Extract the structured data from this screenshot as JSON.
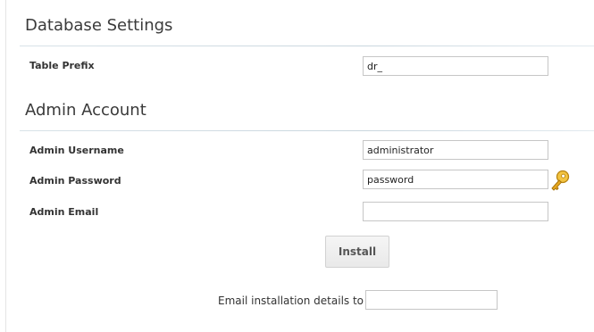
{
  "database_settings": {
    "title": "Database Settings",
    "table_prefix": {
      "label": "Table Prefix",
      "value": "dr_"
    }
  },
  "admin_account": {
    "title": "Admin Account",
    "username": {
      "label": "Admin Username",
      "value": "administrator"
    },
    "password": {
      "label": "Admin Password",
      "value": "password"
    },
    "email": {
      "label": "Admin Email",
      "value": ""
    }
  },
  "actions": {
    "install_label": "Install"
  },
  "email_details": {
    "label": "Email installation details to :",
    "value": ""
  },
  "icons": {
    "password_generator": "key-icon"
  },
  "colors": {
    "divider": "#c9d6de",
    "key_gold": "#e8a81e"
  }
}
